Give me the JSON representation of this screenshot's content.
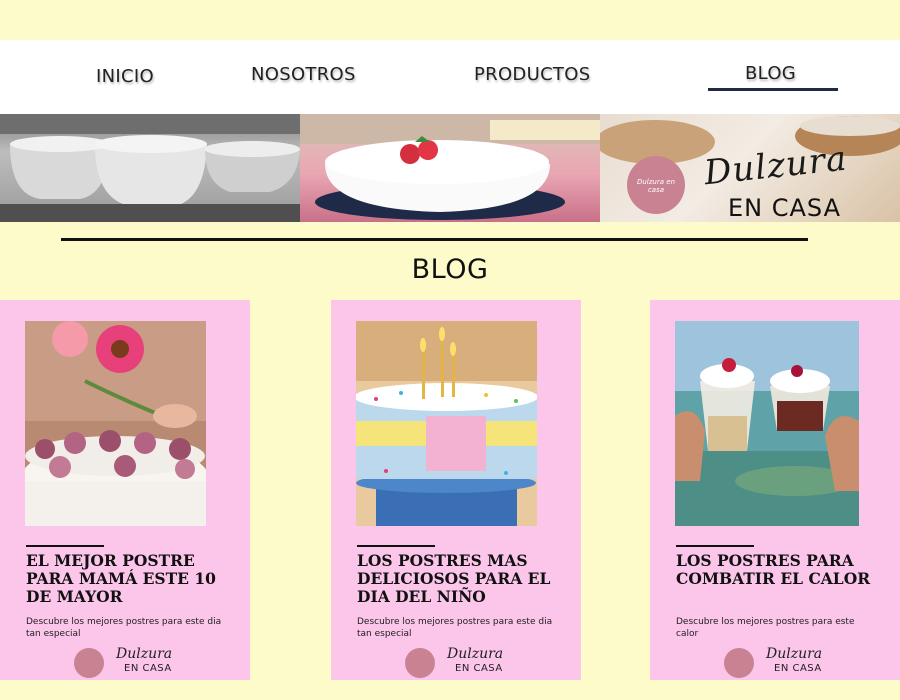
{
  "nav": {
    "items": [
      "INICIO",
      "NOSOTROS",
      "PRODUCTOS",
      "BLOG"
    ],
    "active": "BLOG",
    "active_color": "#1f2a44"
  },
  "brand": {
    "script": "Dulzura",
    "sub": "EN CASA",
    "badge_text": "Dulzura en casa",
    "color": "#c98292"
  },
  "section": {
    "title": "BLOG"
  },
  "cards": [
    {
      "title": "EL MEJOR POSTRE PARA MAMÁ ESTE 10 DE MAYOR",
      "desc": "Descubre los mejores postres para este dia tan especial",
      "photo": "cake-with-flowers"
    },
    {
      "title": "LOS POSTRES MAS DELICIOSOS PARA EL DIA DEL NIÑO",
      "desc": "Descubre los mejores postres para este dia tan especial",
      "photo": "birthday-cake-with-candles"
    },
    {
      "title": "LOS POSTRES PARA COMBATIR EL CALOR",
      "desc": "Descubre los mejores postres para este calor",
      "photo": "desserts-at-beach"
    }
  ],
  "logo": {
    "script": "Dulzura",
    "sub": "EN CASA"
  },
  "colors": {
    "background": "#fdfbc9",
    "card": "#fcc5ea",
    "nav": "#ffffff"
  }
}
